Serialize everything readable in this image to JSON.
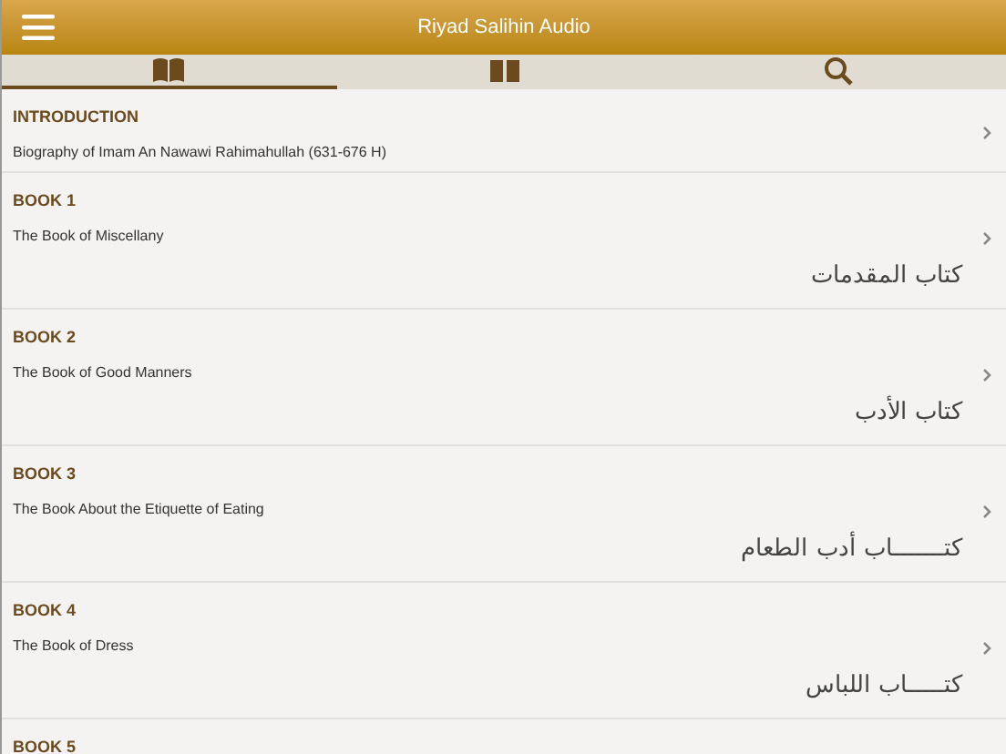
{
  "header": {
    "title": "Riyad Salihin Audio"
  },
  "tabs": [
    {
      "kind": "open-book",
      "selected": true
    },
    {
      "kind": "closed-book",
      "selected": false
    },
    {
      "kind": "search",
      "selected": false
    }
  ],
  "sections": [
    {
      "heading": "INTRODUCTION",
      "title": "Biography of Imam An Nawawi Rahimahullah (631-676 H)"
    },
    {
      "heading": "BOOK 1",
      "title": "The Book of Miscellany",
      "arabic": "كتاب المقدمات"
    },
    {
      "heading": "BOOK 2",
      "title": "The Book of Good Manners",
      "arabic": "كتاب الأدب"
    },
    {
      "heading": "BOOK 3",
      "title": "The Book About the Etiquette of Eating",
      "arabic": "كتـــــــاب أدب الطعام"
    },
    {
      "heading": "BOOK 4",
      "title": "The Book of Dress",
      "arabic": "كتـــــاب اللباس"
    },
    {
      "heading": "BOOK 5"
    }
  ]
}
